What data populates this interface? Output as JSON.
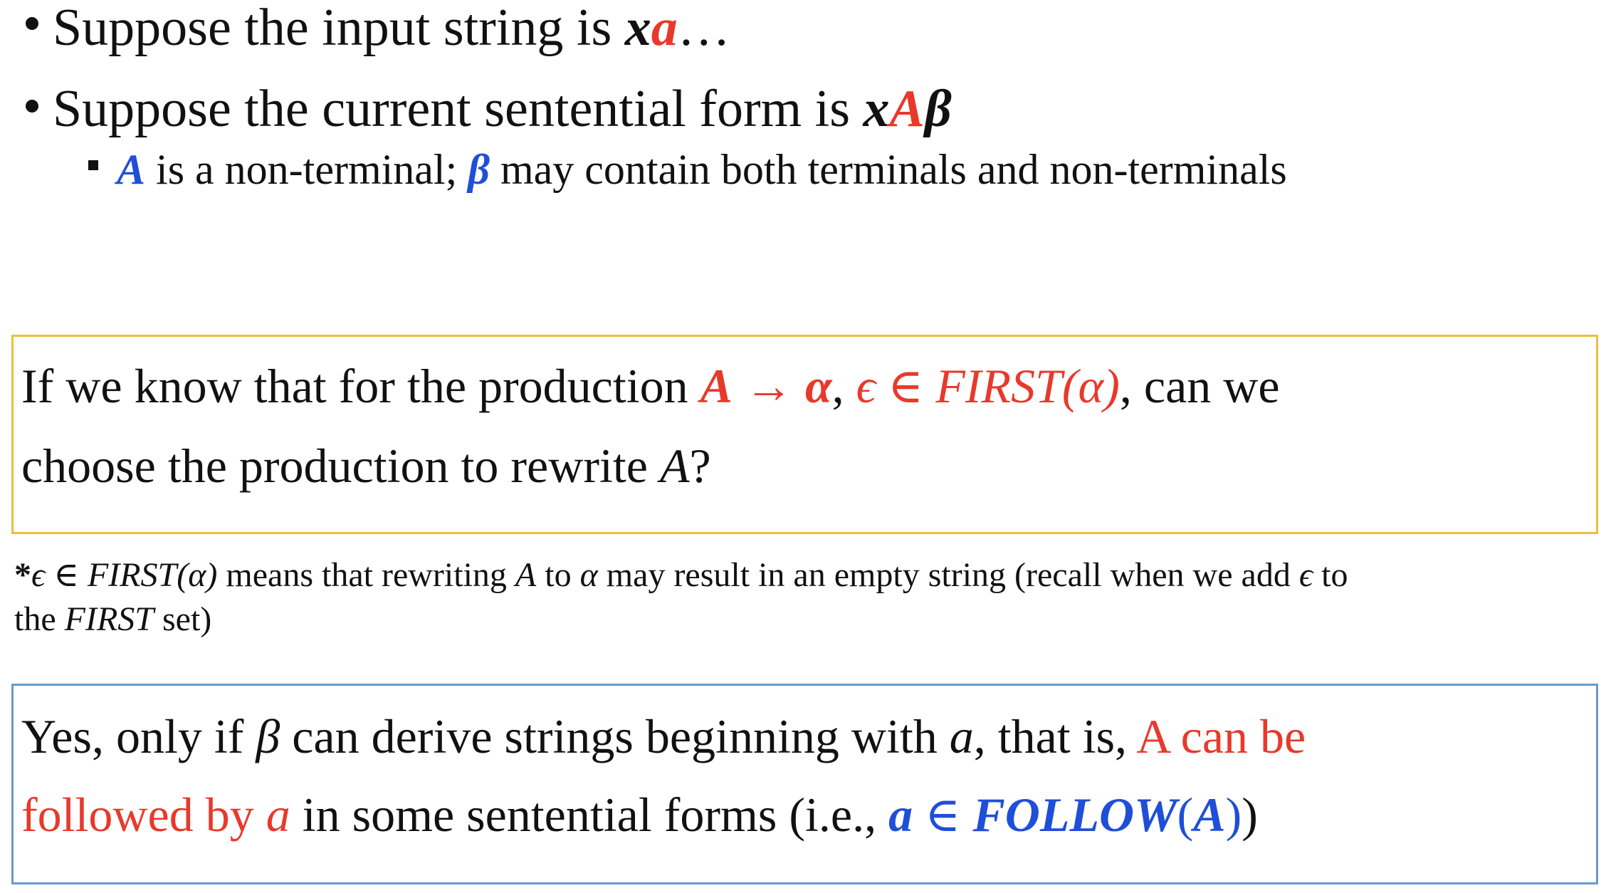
{
  "colors": {
    "red": "#e8392b",
    "blue": "#1f4fd8",
    "question_border": "#f1bd3d",
    "answer_border": "#6a9ad0"
  },
  "bullets": [
    {
      "prefix": "Suppose the input string is ",
      "x": "x",
      "a": "a",
      "suffix": "…"
    },
    {
      "prefix": "Suppose the current sentential form is ",
      "x": "x",
      "A": "A",
      "beta": "β"
    }
  ],
  "sub_bullet": {
    "A": "A",
    "text1": " is a non-terminal; ",
    "beta": "β",
    "text2": " may contain both terminals and non-terminals"
  },
  "question": {
    "line1_prefix": "If we know that for the production ",
    "prod_A": "A",
    "arrow": " → ",
    "prod_alpha": "α",
    "comma1": ", ",
    "eps": "ϵ ∈ ",
    "first": "FIRST",
    "first_arg": "(α)",
    "line1_suffix": ", can we",
    "line2_prefix": "choose the production to rewrite ",
    "line2_A": "A",
    "line2_suffix": "?"
  },
  "footnote": {
    "star": "*",
    "eps": "ϵ ∈ ",
    "first": "FIRST",
    "first_arg": "(α)",
    "t1": " means that rewriting ",
    "A": "A",
    "t2": " to ",
    "alpha": "α",
    "t3": " may result in an empty string (recall when we add ",
    "eps2": "ϵ",
    "t4": " to",
    "line2_prefix": "the ",
    "line2_first": "FIRST",
    "line2_suffix": " set)"
  },
  "answer": {
    "l1_prefix": "Yes, only if ",
    "beta": "β",
    "l1_mid": " can derive strings beginning with ",
    "a1": "a",
    "l1_mid2": ", that is, ",
    "l1_red": "A can be",
    "l2_red": "followed by ",
    "l2_a": "a",
    "l2_mid": " in some sentential forms (i.e., ",
    "l2_a2": "a",
    "l2_in": " ∈ ",
    "follow": "FOLLOW",
    "follow_open": "(",
    "follow_A": "A",
    "follow_close": ")",
    "l2_suffix": ")"
  }
}
